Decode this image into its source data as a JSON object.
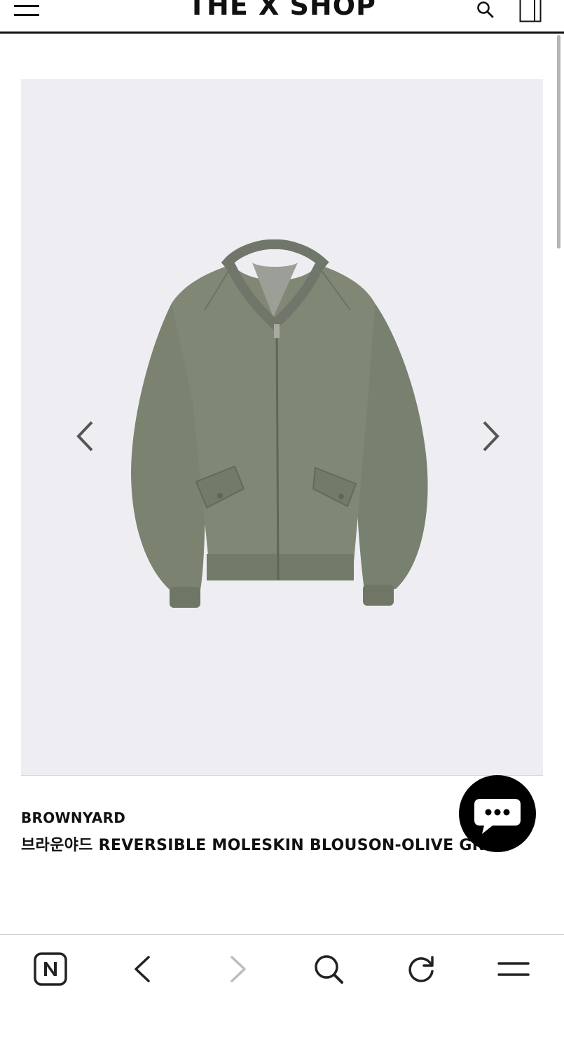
{
  "header": {
    "logo": "THE X SHOP",
    "menu_icon": "hamburger-menu-icon",
    "search_icon": "search-icon",
    "cart_icon": "shopping-bag-icon"
  },
  "product": {
    "brand": "BROWNYARD",
    "name": "브라운야드 REVERSIBLE MOLESKIN BLOUSON-OLIVE GRAY",
    "image_alt": "olive bomber jacket",
    "jacket_color": "#7b8270",
    "background_color": "#eeeef2"
  },
  "carousel": {
    "prev_icon": "chevron-left-icon",
    "next_icon": "chevron-right-icon"
  },
  "chat": {
    "icon": "chat-bubble-icon"
  },
  "browser_bar": {
    "icons": [
      "naver-icon",
      "back-icon",
      "forward-icon",
      "search-icon",
      "refresh-icon",
      "menu-icon"
    ]
  }
}
